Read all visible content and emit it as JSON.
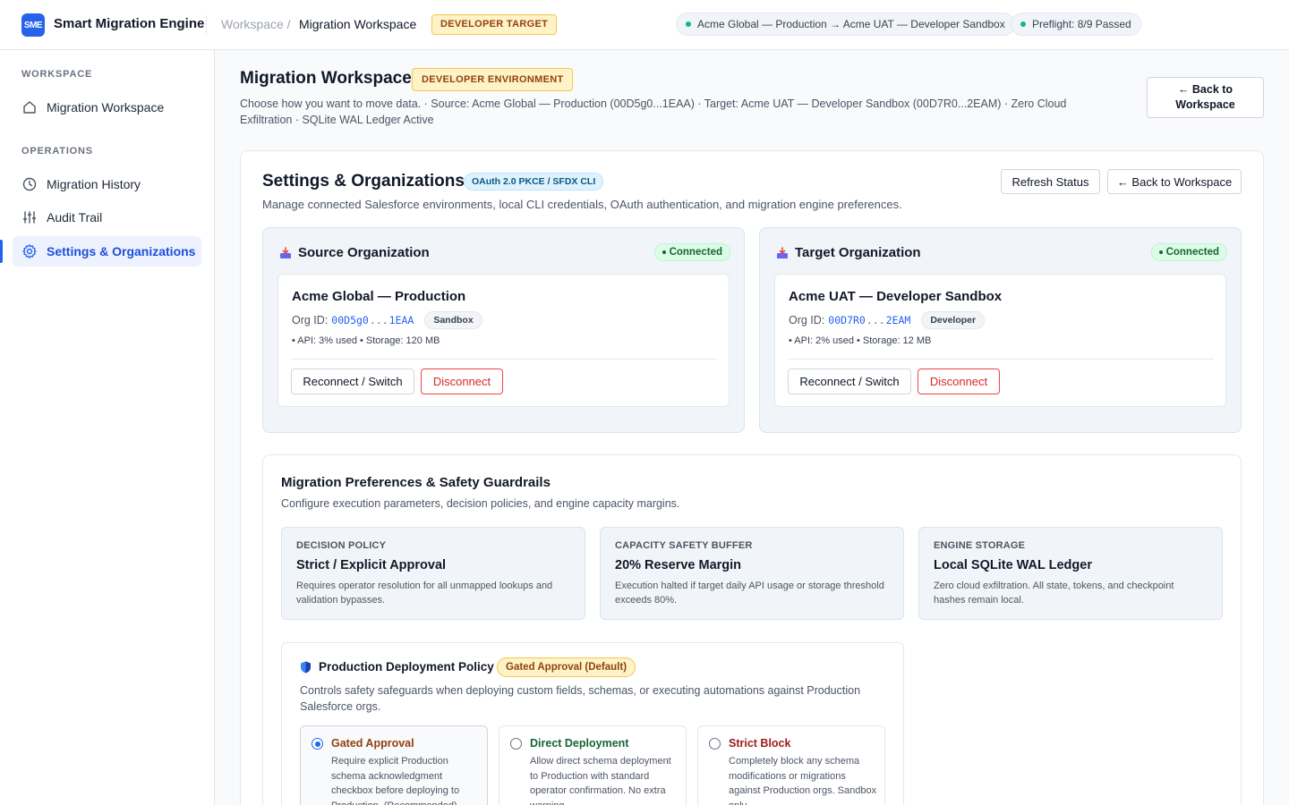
{
  "topbar": {
    "logo_text": "SME",
    "app_title": "Smart Migration Engine",
    "breadcrumb_root": "Workspace /",
    "breadcrumb_current": "Migration Workspace",
    "target_badge": "DEVELOPER TARGET",
    "connection_pill": "Acme Global — Production → Acme UAT — Developer Sandbox",
    "preflight_pill": "Preflight: 8/9 Passed"
  },
  "sidebar": {
    "section_workspace": "WORKSPACE",
    "section_operations": "OPERATIONS",
    "items": [
      {
        "label": "Migration Workspace",
        "icon": "home-icon"
      },
      {
        "label": "Migration History",
        "icon": "clock-icon"
      },
      {
        "label": "Audit Trail",
        "icon": "sliders-icon"
      },
      {
        "label": "Settings & Organizations",
        "icon": "gear-icon",
        "active": true
      }
    ]
  },
  "header": {
    "title": "Migration Workspace",
    "env_badge": "DEVELOPER ENVIRONMENT",
    "subtitle": "Choose how you want to move data.  ·  Source: Acme Global — Production (00D5g0...1EAA)  ·  Target: Acme UAT — Developer Sandbox (00D7R0...2EAM)  ·  Zero Cloud Exfiltration · SQLite WAL Ledger Active",
    "back_button": "← Back to Workspace"
  },
  "settings": {
    "title": "Settings & Organizations",
    "auth_badge": "OAuth 2.0 PKCE / SFDX CLI",
    "subtitle": "Manage connected Salesforce environments, local CLI credentials, OAuth authentication, and migration engine preferences.",
    "refresh_button": "Refresh Status",
    "back_button": "← Back to Workspace"
  },
  "orgs": {
    "source": {
      "heading": "Source Organization",
      "status": "Connected",
      "name": "Acme Global — Production",
      "org_id_label": "Org ID:",
      "org_id_start": "00D5g0",
      "org_id_sep": "...",
      "org_id_end": "1EAA",
      "type_tag": "Sandbox",
      "meta": "• API: 3% used • Storage: 120 MB",
      "reconnect": "Reconnect / Switch",
      "disconnect": "Disconnect"
    },
    "target": {
      "heading": "Target Organization",
      "status": "Connected",
      "name": "Acme UAT — Developer Sandbox",
      "org_id_label": "Org ID:",
      "org_id_start": "00D7R0",
      "org_id_sep": "...",
      "org_id_end": "2EAM",
      "type_tag": "Developer",
      "meta": "• API: 2% used • Storage: 12 MB",
      "reconnect": "Reconnect / Switch",
      "disconnect": "Disconnect"
    }
  },
  "preferences": {
    "title": "Migration Preferences & Safety Guardrails",
    "subtitle": "Configure execution parameters, decision policies, and engine capacity margins.",
    "tiles": [
      {
        "label": "DECISION POLICY",
        "value": "Strict / Explicit Approval",
        "desc": "Requires operator resolution for all unmapped lookups and validation bypasses."
      },
      {
        "label": "CAPACITY SAFETY BUFFER",
        "value": "20% Reserve Margin",
        "desc": "Execution halted if target daily API usage or storage threshold exceeds 80%."
      },
      {
        "label": "ENGINE STORAGE",
        "value": "Local SQLite WAL Ledger",
        "desc": "Zero cloud exfiltration. All state, tokens, and checkpoint hashes remain local."
      }
    ]
  },
  "policy": {
    "title": "Production Deployment Policy",
    "badge": "Gated Approval (Default)",
    "subtitle": "Controls safety safeguards when deploying custom fields, schemas, or executing automations against Production Salesforce orgs.",
    "options": [
      {
        "title": "Gated Approval",
        "desc": "Require explicit Production schema acknowledgment checkbox before deploying to Production. (Recommended)",
        "selected": true,
        "color": "#92400e"
      },
      {
        "title": "Direct Deployment",
        "desc": "Allow direct schema deployment to Production with standard operator confirmation. No extra warning.",
        "selected": false,
        "color": "#166534"
      },
      {
        "title": "Strict Block",
        "desc": "Completely block any schema modifications or migrations against Production orgs. Sandbox only.",
        "selected": false,
        "color": "#991b1b"
      }
    ]
  },
  "colors": {
    "accent": "#2563eb",
    "success": "#166534",
    "danger": "#dc2626",
    "warning": "#92400e"
  }
}
